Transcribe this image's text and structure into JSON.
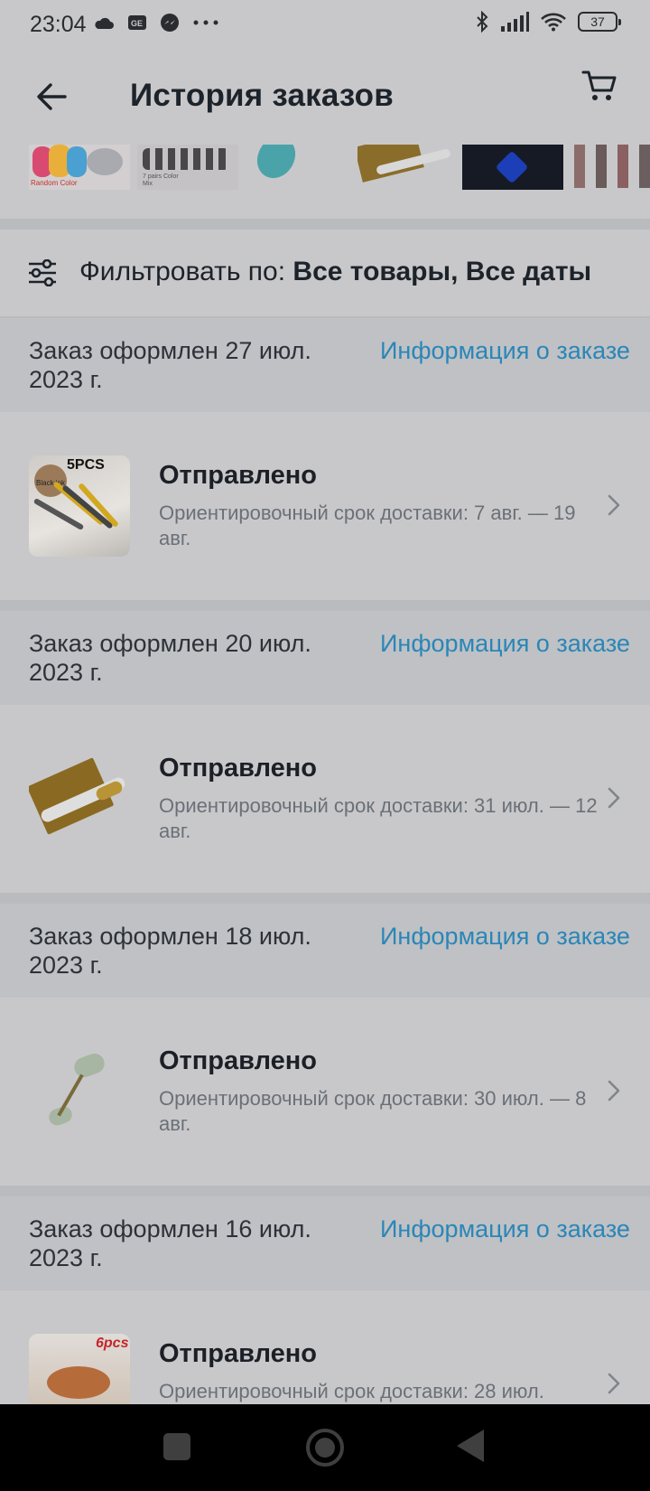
{
  "status_bar": {
    "time": "23:04",
    "battery": "37",
    "icons": [
      "cloud-icon",
      "gallery-icon",
      "messenger-icon",
      "more-dots-icon",
      "bluetooth-icon",
      "signal-icon",
      "wifi-icon",
      "battery-icon"
    ]
  },
  "header": {
    "title": "История заказов",
    "back_icon": "arrow-left-icon",
    "cart_icon": "cart-icon"
  },
  "thumbnails": {
    "item1_text": "Random Color",
    "item2_text": "7 pairs Color Mix"
  },
  "filter": {
    "label": "Фильтровать по: ",
    "value": "Все товары, Все даты"
  },
  "orders": [
    {
      "placed": "Заказ оформлен 27 июл. 2023 г.",
      "info_link": "Информация о заказе",
      "status": "Отправлено",
      "eta": "Ориентировочный срок доставки: 7 авг. — 19 авг.",
      "image_badge": "5PCS",
      "image_caption": "Black ink"
    },
    {
      "placed": "Заказ оформлен 20 июл. 2023 г.",
      "info_link": "Информация о заказе",
      "status": "Отправлено",
      "eta": "Ориентировочный срок доставки: 31 июл. — 12 авг."
    },
    {
      "placed": "Заказ оформлен 18 июл. 2023 г.",
      "info_link": "Информация о заказе",
      "status": "Отправлено",
      "eta": "Ориентировочный срок доставки: 30 июл. — 8 авг."
    },
    {
      "placed": "Заказ оформлен 16 июл. 2023 г.",
      "info_link": "Информация о заказе",
      "status": "Отправлено",
      "eta": "Ориентировочный срок доставки: 28 июл.",
      "image_badge": "6pcs"
    }
  ],
  "colors": {
    "background": "#c8c8ca",
    "header_band": "#bfc1c4",
    "link": "#2a86b8",
    "text": "#1c2026",
    "muted": "#6b7078"
  }
}
